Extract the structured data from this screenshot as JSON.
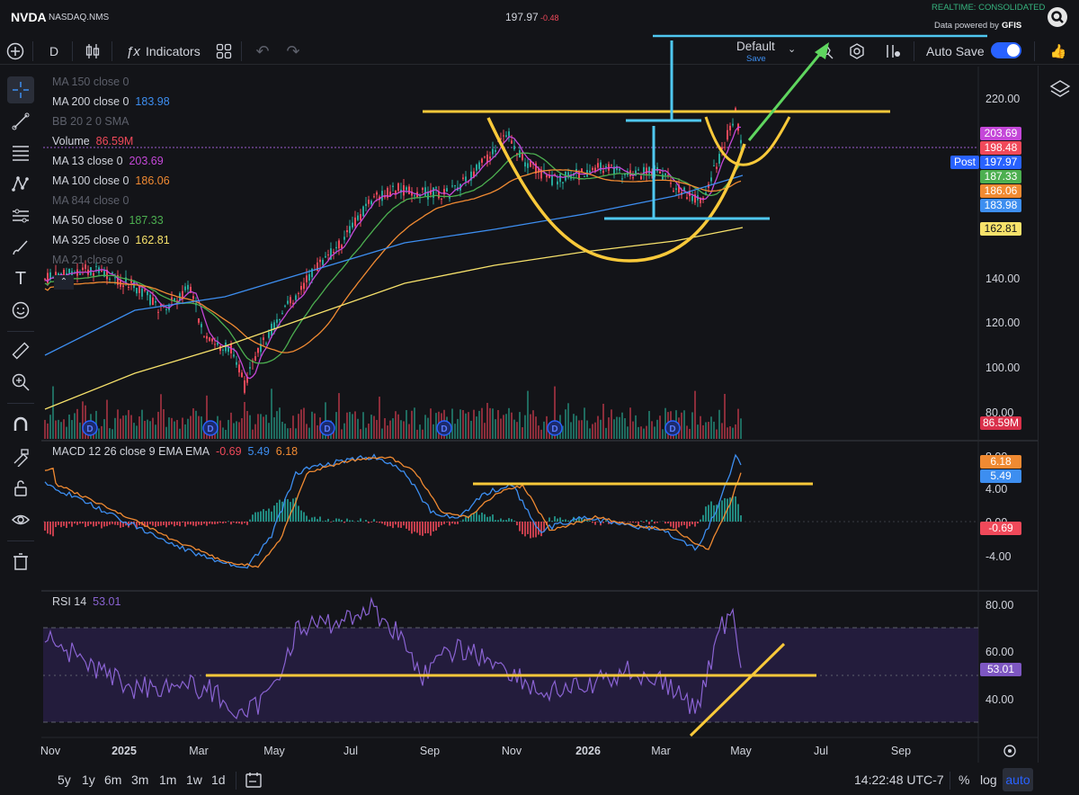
{
  "header": {
    "symbol": "NVDA",
    "exchange": "NASDAQ.NMS",
    "price": "197.97",
    "change": "-0.48",
    "realtime": "REALTIME: CONSOLIDATED",
    "powered_by": "Data powered by",
    "provider": "GFIS"
  },
  "toolbar": {
    "interval": "D",
    "indicators_label": "Indicators",
    "layout_name": "Default",
    "layout_save": "Save",
    "autosave_label": "Auto Save"
  },
  "legend": {
    "ma150": {
      "label": "MA 150 close 0",
      "value": ""
    },
    "ma200": {
      "label": "MA 200 close 0",
      "value": "183.98"
    },
    "bb": {
      "label": "BB 20 2 0 SMA",
      "value": ""
    },
    "volume": {
      "label": "Volume",
      "value": "86.59M"
    },
    "ma13": {
      "label": "MA 13 close 0",
      "value": "203.69"
    },
    "ma100": {
      "label": "MA 100 close 0",
      "value": "186.06"
    },
    "ma844": {
      "label": "MA 844 close 0",
      "value": ""
    },
    "ma50": {
      "label": "MA 50 close 0",
      "value": "187.33"
    },
    "ma325": {
      "label": "MA 325 close 0",
      "value": "162.81"
    },
    "ma21": {
      "label": "MA 21 close 0",
      "value": ""
    }
  },
  "price_axis": [
    "220.00",
    "140.00",
    "120.00",
    "100.00",
    "80.00"
  ],
  "price_badges": {
    "ma13": "203.69",
    "prev": "198.48",
    "post_label": "Post",
    "post": "197.97",
    "ma50": "187.33",
    "ma100": "186.06",
    "ma200": "183.98",
    "ma325": "162.81",
    "volume": "86.59M"
  },
  "macd": {
    "label": "MACD 12 26 close 9 EMA EMA",
    "hist": "-0.69",
    "macd": "5.49",
    "signal": "6.18",
    "axis": [
      "8.00",
      "4.00",
      "0.00",
      "-4.00"
    ],
    "badges": {
      "signal": "6.18",
      "macd": "5.49",
      "hist": "-0.69"
    }
  },
  "rsi": {
    "label": "RSI 14",
    "value": "53.01",
    "axis": [
      "80.00",
      "60.00",
      "40.00"
    ],
    "badge": "53.01"
  },
  "x_axis": [
    "Nov",
    "2025",
    "Mar",
    "May",
    "Jul",
    "Sep",
    "Nov",
    "2026",
    "Mar",
    "May",
    "Jul",
    "Sep"
  ],
  "bottom": {
    "periods": [
      "5y",
      "1y",
      "6m",
      "3m",
      "1m",
      "1w",
      "1d"
    ],
    "time": "14:22:48 UTC-7",
    "percent": "%",
    "log": "log",
    "auto": "auto"
  },
  "colors": {
    "ma13": "#c447d8",
    "ma100": "#f08a32",
    "ma50": "#4caf50",
    "ma200": "#3d8ef0",
    "ma325": "#f7e26b",
    "volume_red": "#f0495a",
    "accent": "#2962ff",
    "annot_yellow": "#f9c93a",
    "annot_cyan": "#4fc8f0",
    "annot_green": "#5fd65f"
  }
}
